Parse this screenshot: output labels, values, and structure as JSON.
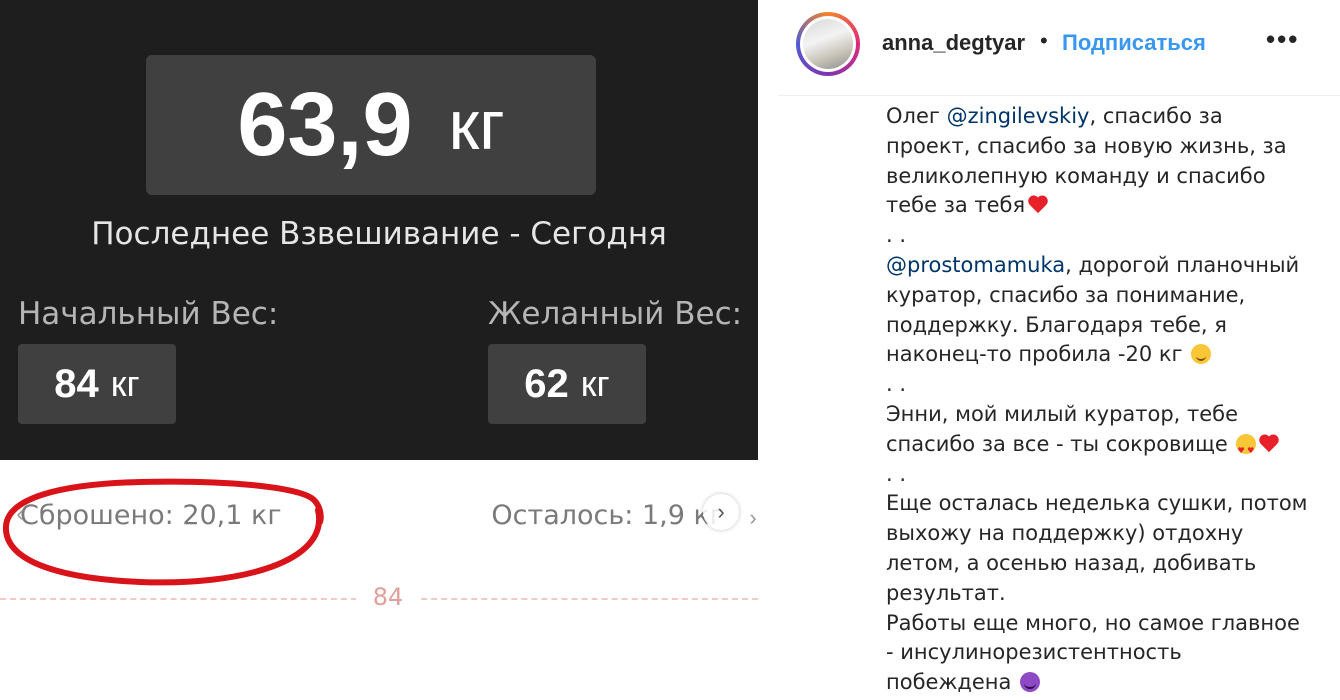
{
  "app": {
    "current_weight": {
      "value": "63,9",
      "unit": "кг"
    },
    "last_weighing": "Последнее Взвешивание - Сегодня",
    "start_weight": {
      "label": "Начальный Вес:",
      "value": "84",
      "unit": "кг"
    },
    "goal_weight": {
      "label": "Желанный Вес:",
      "value": "62",
      "unit": "кг"
    },
    "lost": "Сброшено: 20,1 кг",
    "remaining": "Осталось: 1,9 кг",
    "scale_start": "84",
    "annotation_color": "#d9131a"
  },
  "post": {
    "username": "anna_degtyar",
    "separator": "•",
    "follow_label": "Подписаться",
    "more_icon": "•••",
    "caption": {
      "l1_a": "Олег ",
      "l1_mention": "@zingilevskiy",
      "l1_b": ", спасибо за",
      "l2": "проект, спасибо за новую жизнь, за",
      "l3": "великолепную команду и спасибо",
      "l4": "тебе за тебя",
      "sep1": ". .",
      "l5_mention": "@prostomamuka",
      "l5_b": ", дорогой планочный",
      "l6": "куратор, спасибо за понимание,",
      "l7": "поддержку. Благодаря тебе, я",
      "l8": "наконец-то пробила -20 кг",
      "sep2": ". .",
      "l9": "Энни, мой милый куратор, тебе",
      "l10": "спасибо за все - ты сокровище",
      "sep3": ". .",
      "l11": "Еще осталась неделька сушки, потом",
      "l12": "выхожу на поддержку) отдохну",
      "l13": "летом, а осенью назад, добивать",
      "l14": "результат.",
      "l15": "Работы еще много, но самое главное",
      "l16": "- инсулинорезистентность",
      "l17": "побеждена"
    },
    "colors": {
      "follow": "#3897f0",
      "mention": "#003569"
    }
  }
}
